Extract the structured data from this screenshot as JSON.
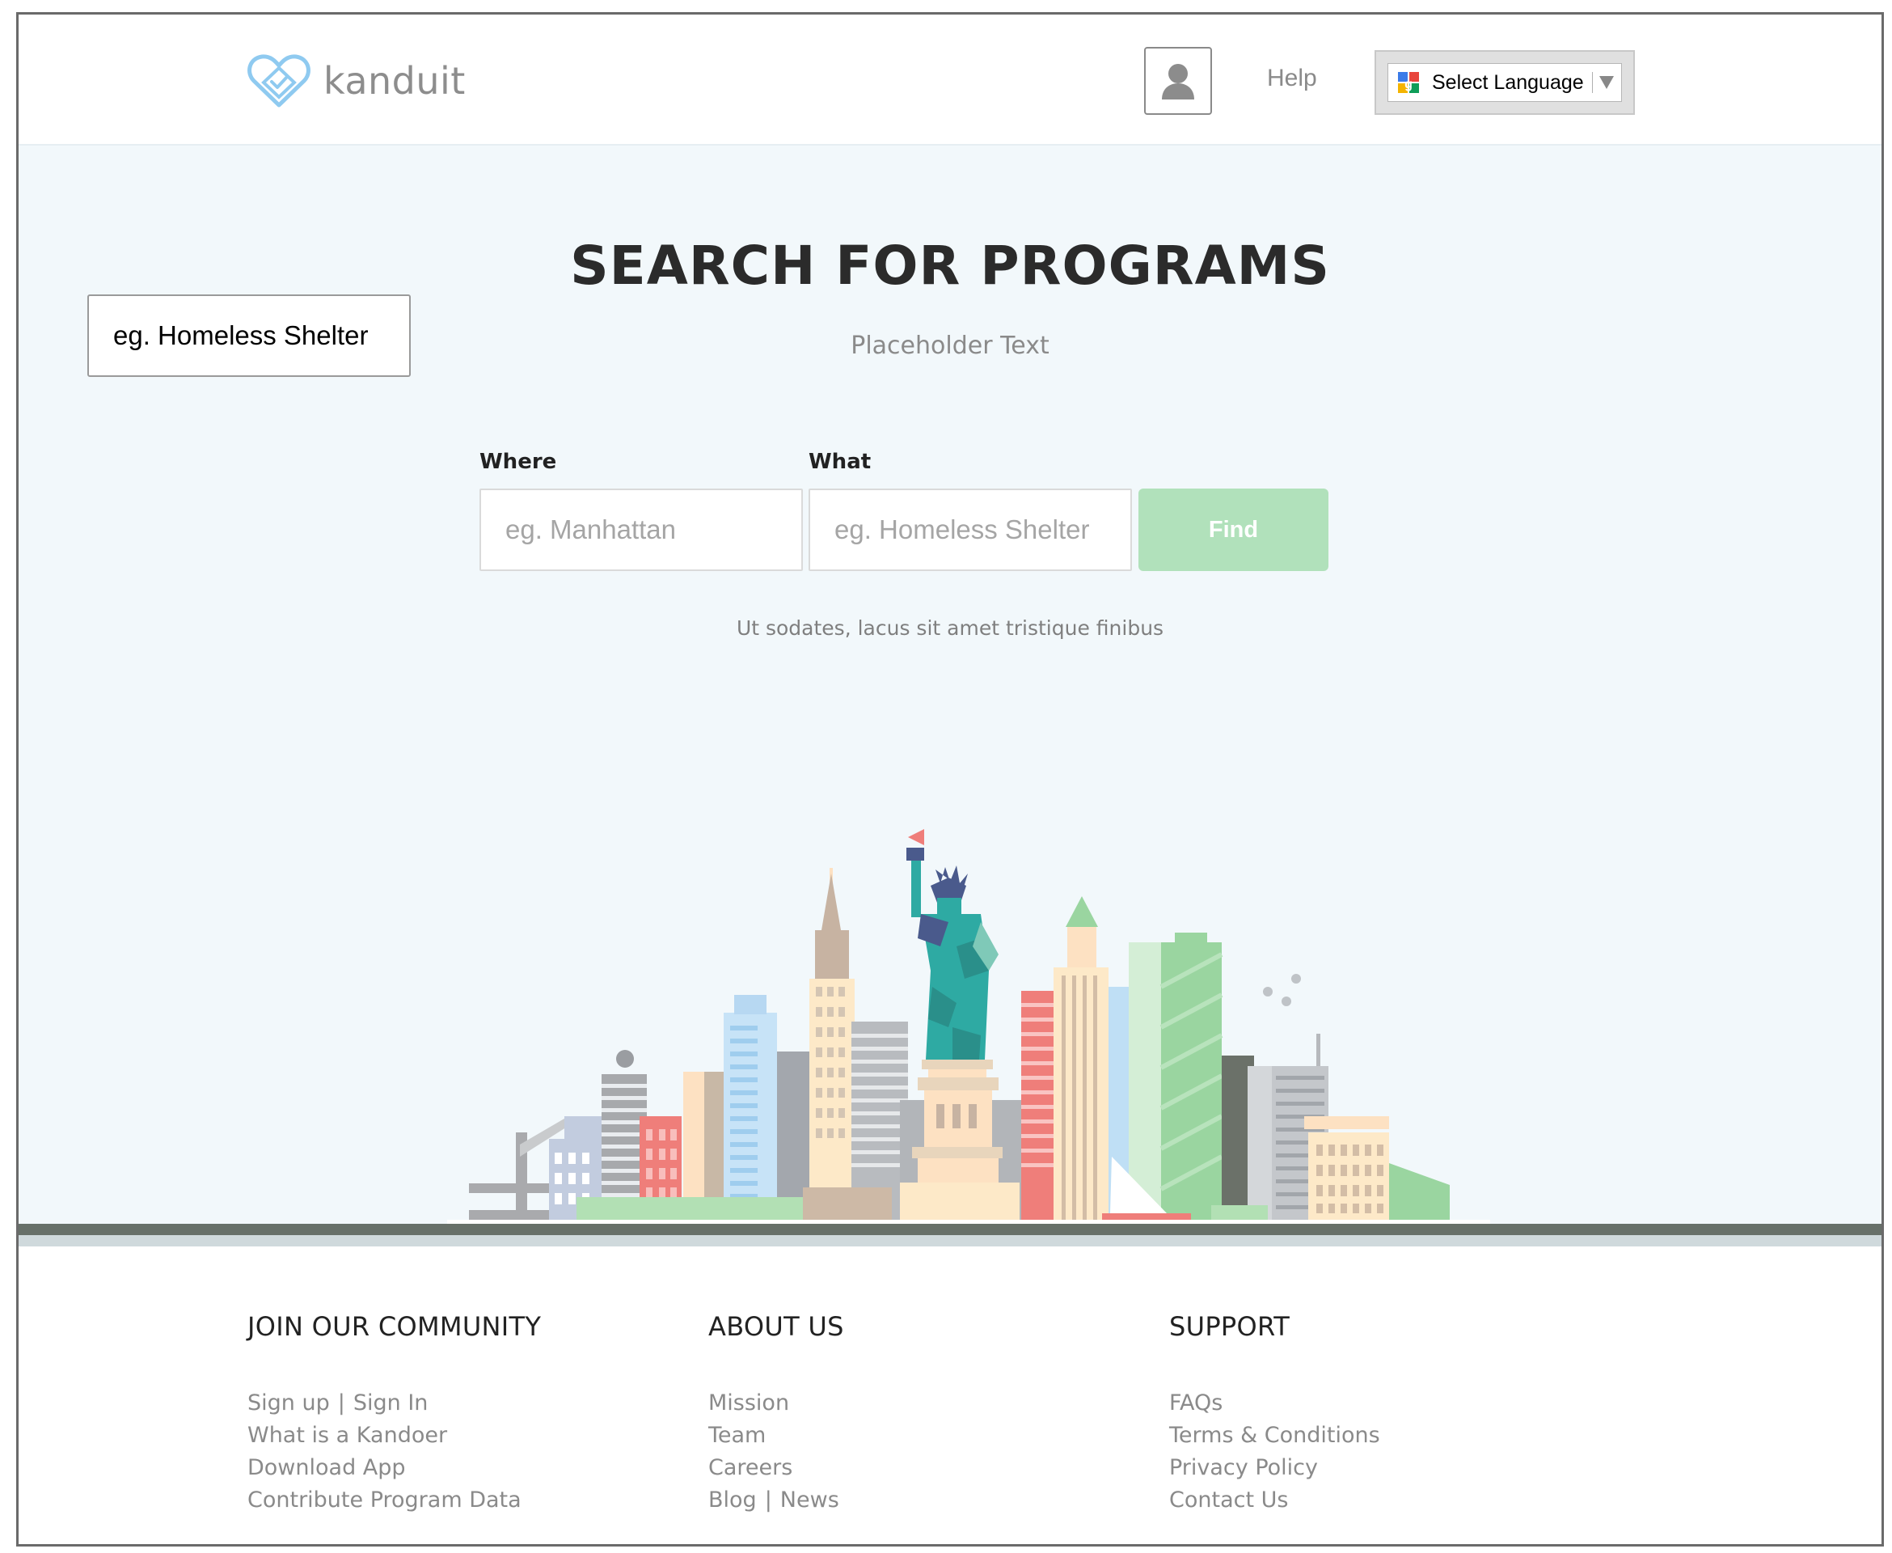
{
  "header": {
    "logo_text": "kanduit",
    "help_label": "Help",
    "language_label": "Select Language"
  },
  "hero": {
    "floating_field_value": "eg. Homeless Shelter",
    "title": "SEARCH FOR PROGRAMS",
    "subtitle": "Placeholder Text",
    "where_label": "Where",
    "where_placeholder": "eg. Manhattan",
    "what_label": "What",
    "what_placeholder": "eg. Homeless Shelter",
    "find_label": "Find",
    "tagline": "Ut sodates, lacus sit amet tristique finibus"
  },
  "footer": {
    "community": {
      "heading": "JOIN OUR COMMUNITY",
      "signup": "Sign up",
      "separator": "|",
      "signin": "Sign In",
      "links": [
        "What is a Kandoer",
        "Download App",
        "Contribute Program Data"
      ]
    },
    "about": {
      "heading": "ABOUT US",
      "links": [
        "Mission",
        "Team",
        "Careers"
      ],
      "blog": "Blog",
      "separator": "|",
      "news": "News"
    },
    "support": {
      "heading": "SUPPORT",
      "links": [
        "FAQs",
        "Terms & Conditions",
        "Privacy Policy",
        "Contact Us"
      ]
    }
  },
  "colors": {
    "find_button": "#b1e1bb",
    "hero_background": "#f2f8fb",
    "divider_dark": "#677069",
    "divider_light": "#cfd9dc",
    "logo_blue": "#8fcaf0"
  },
  "icons": [
    "heart-check-logo-icon",
    "user-avatar-icon",
    "google-translate-icon",
    "dropdown-arrow-icon"
  ]
}
